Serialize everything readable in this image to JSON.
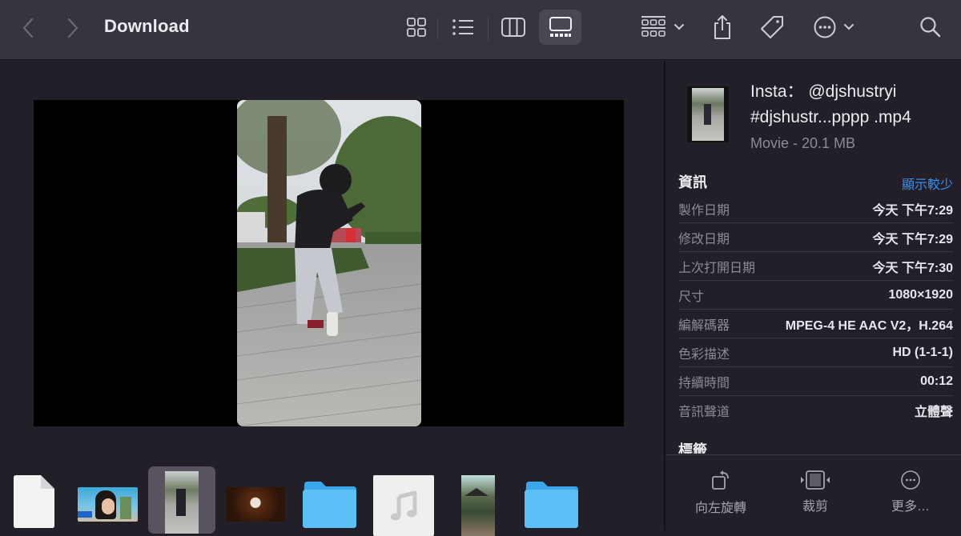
{
  "window": {
    "title": "Download"
  },
  "toolbar": {
    "back_icon": "chevron-left-icon",
    "forward_icon": "chevron-right-icon",
    "view_modes": [
      {
        "name": "icon-view",
        "icon": "grid-icon",
        "active": false
      },
      {
        "name": "list-view",
        "icon": "list-icon",
        "active": false
      },
      {
        "name": "column-view",
        "icon": "columns-icon",
        "active": false
      },
      {
        "name": "gallery-view",
        "icon": "gallery-icon",
        "active": true
      }
    ],
    "group_icon": "group-icon",
    "share_icon": "share-icon",
    "tag_icon": "tag-icon",
    "action_icon": "ellipsis-circle-icon",
    "search_icon": "search-icon"
  },
  "gallery": {
    "preview_subject": "video frame: person dancing on brick plaza under trees",
    "thumbnails": [
      {
        "kind": "document",
        "icon": "blank-document-icon",
        "selected": false
      },
      {
        "kind": "video",
        "description": "woman holding drink, blue sky",
        "selected": false
      },
      {
        "kind": "video",
        "description": "person dancing on plaza",
        "selected": true
      },
      {
        "kind": "image",
        "description": "dim room with round lamp",
        "selected": false
      },
      {
        "kind": "folder",
        "icon": "folder-icon",
        "selected": false
      },
      {
        "kind": "audio",
        "icon": "music-note-icon",
        "selected": false
      },
      {
        "kind": "image",
        "description": "temple pavilion with trees",
        "selected": false
      },
      {
        "kind": "folder",
        "icon": "folder-icon",
        "selected": false
      }
    ]
  },
  "inspector": {
    "file_name_line1": "Insta： @djshustryi",
    "file_name_line2": "#djshustr...pppp .mp4",
    "file_kind": "Movie - 20.1 MB",
    "info_title": "資訊",
    "show_less": "顯示較少",
    "rows": [
      {
        "label": "製作日期",
        "value": "今天 下午7:29"
      },
      {
        "label": "修改日期",
        "value": "今天 下午7:29"
      },
      {
        "label": "上次打開日期",
        "value": "今天 下午7:30"
      },
      {
        "label": "尺寸",
        "value": "1080×1920"
      },
      {
        "label": "編解碼器",
        "value": "MPEG-4 HE AAC V2，H.264"
      },
      {
        "label": "色彩描述",
        "value": "HD (1-1-1)"
      },
      {
        "label": "持續時間",
        "value": "00:12"
      },
      {
        "label": "音訊聲道",
        "value": "立體聲"
      }
    ],
    "tags_title": "標籤",
    "actions": [
      {
        "label": "向左旋轉",
        "icon": "rotate-left-icon"
      },
      {
        "label": "裁剪",
        "icon": "trim-icon"
      },
      {
        "label": "更多…",
        "icon": "more-icon"
      }
    ]
  },
  "colors": {
    "toolbar_bg": "#38343f",
    "content_bg": "#221f28",
    "accent_link": "#3b8ef0",
    "folder_blue": "#4fb4f5"
  }
}
